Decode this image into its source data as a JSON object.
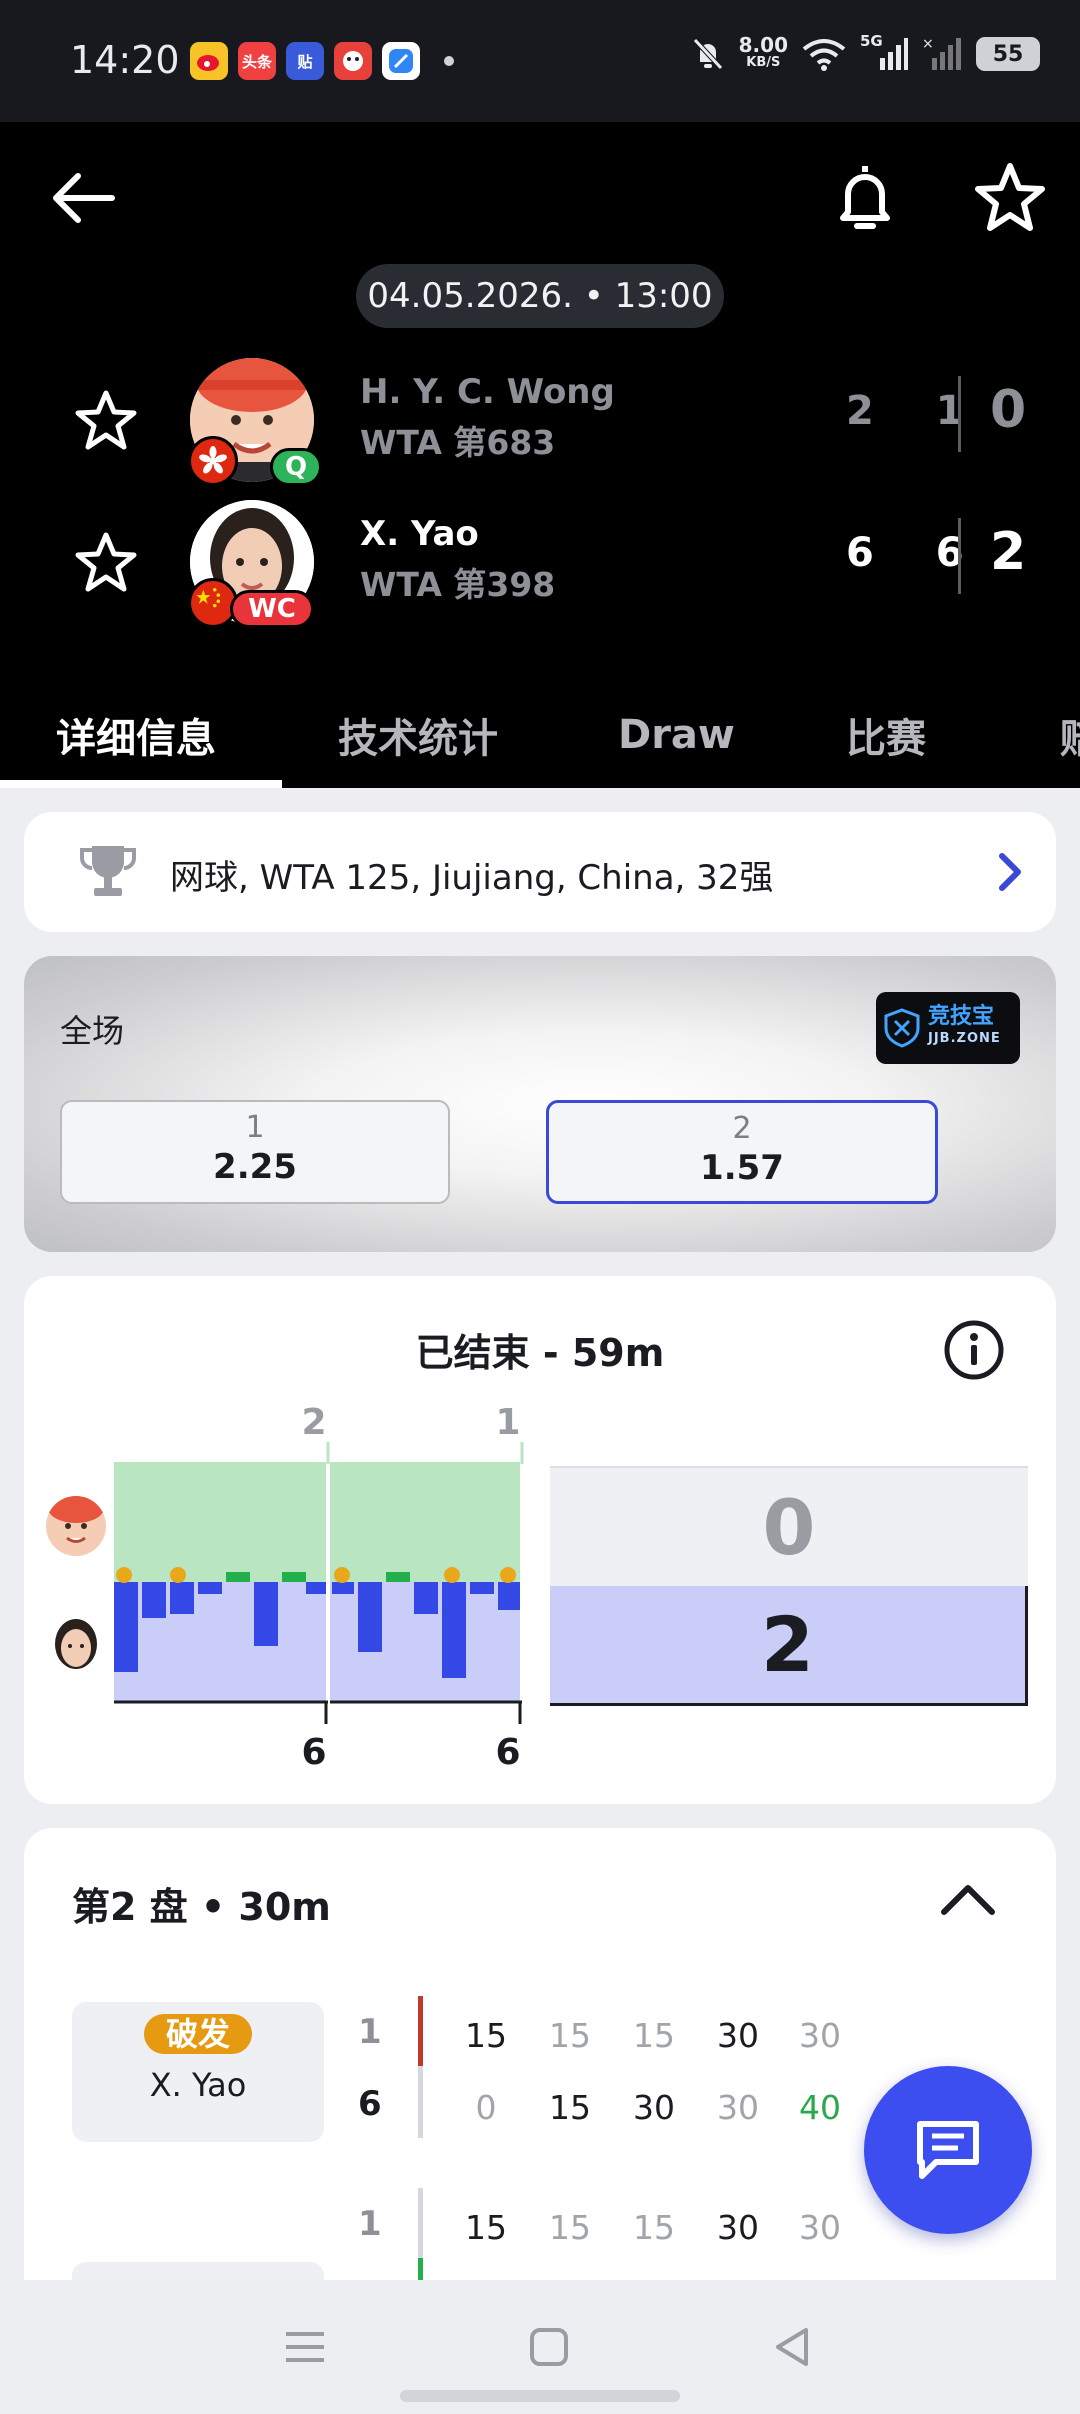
{
  "status_bar": {
    "time": "14:20",
    "app_icons": [
      {
        "name": "weibo-icon",
        "label": "",
        "color": "#e6162d"
      },
      {
        "name": "toutiao-icon",
        "label": "头条",
        "color": "#f04142"
      },
      {
        "name": "tieba-icon",
        "label": "贴",
        "color": "#3a5bd9"
      },
      {
        "name": "game-icon",
        "label": "",
        "color": "#e8403a"
      },
      {
        "name": "browser-icon",
        "label": "",
        "color": "#2f86f5"
      }
    ],
    "net_speed": "8.00",
    "net_unit": "KB/S",
    "signal_label": "5G",
    "battery": "55"
  },
  "header": {
    "date_time": "04.05.2026. • 13:00",
    "players": [
      {
        "name": "H. Y. C. Wong",
        "rank": "WTA 第683",
        "seed": "Q",
        "sets": "2 1",
        "total": "0",
        "flag": "hong-kong-flag"
      },
      {
        "name": "X. Yao",
        "rank": "WTA 第398",
        "seed": "WC",
        "sets": "6 6",
        "total": "2",
        "flag": "china-flag"
      }
    ],
    "tabs": [
      {
        "label": "详细信息",
        "active": true
      },
      {
        "label": "技术统计",
        "active": false
      },
      {
        "label": "Draw",
        "active": false
      },
      {
        "label": "比赛",
        "active": false
      },
      {
        "label": "赔",
        "active": false
      }
    ]
  },
  "league": {
    "text": "网球, WTA 125, Jiujiang, China, 32强"
  },
  "odds": {
    "title": "全场",
    "brand_main": "竞技宝",
    "brand_sub": "JJB.ZONE",
    "options": [
      {
        "label": "1",
        "value": "2.25",
        "selected": false
      },
      {
        "label": "2",
        "value": "1.57",
        "selected": true
      }
    ]
  },
  "momentum": {
    "title": "已结束 - 59m",
    "set_top_scores": [
      "2",
      "1"
    ],
    "set_bottom_scores": [
      "6",
      "6"
    ],
    "current_set": {
      "player1": "0",
      "player2": "2"
    },
    "colors": {
      "player1": "#b9e5c1",
      "player2": "#c9cdf7",
      "bar": "#3448e6",
      "break": "#e8a81a",
      "hold_green": "#22b04a"
    }
  },
  "set_detail": {
    "title": "第2 盘 • 30m",
    "break_badge": "破发",
    "game_player": "X. Yao",
    "games": [
      {
        "row1": {
          "set_score": "1",
          "points": [
            "15",
            "15",
            "15",
            "30",
            "30"
          ]
        },
        "row2": {
          "set_score": "6",
          "points": [
            "0",
            "15",
            "30",
            "30",
            "40"
          ]
        }
      },
      {
        "row1": {
          "set_score": "1",
          "points": [
            "15",
            "15",
            "15",
            "30",
            "30"
          ]
        }
      }
    ]
  }
}
